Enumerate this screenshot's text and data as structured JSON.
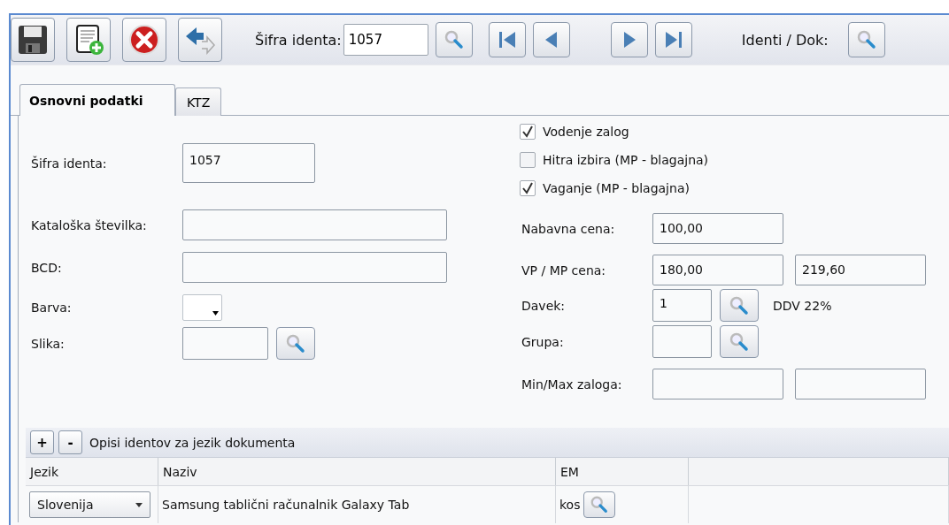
{
  "toolbar": {
    "search_label": "Šifra identa:",
    "search_value": "1057",
    "lookup_label": "Identi / Dok:"
  },
  "tabs": [
    {
      "label": "Osnovni podatki",
      "selected": true
    },
    {
      "label": "KTZ",
      "selected": false
    }
  ],
  "left_fields": [
    {
      "kind": "text",
      "label": "Šifra identa:",
      "value": "1057"
    },
    {
      "kind": "wide",
      "label": "Kataloška številka:"
    },
    {
      "kind": "wide",
      "label": "BCD:"
    },
    {
      "kind": "select",
      "label": "Barva:"
    },
    {
      "kind": "lookup",
      "label": "Slika:"
    }
  ],
  "checkboxes": [
    {
      "label": "Vodenje zalog",
      "checked": true
    },
    {
      "label": "Hitra izbira (MP - blagajna)",
      "checked": false
    },
    {
      "label": "Vaganje (MP - blagajna)",
      "checked": true
    }
  ],
  "right_fields": [
    {
      "kind": "single",
      "label": "Nabavna cena:",
      "values": [
        "100,00"
      ]
    },
    {
      "kind": "pair",
      "label": "VP / MP cena:",
      "values": [
        "180,00",
        "219,60"
      ]
    },
    {
      "kind": "lookup",
      "label": "Davek:",
      "values": [
        "1"
      ],
      "note": "DDV 22%"
    },
    {
      "kind": "lookup",
      "label": "Grupa:"
    },
    {
      "kind": "pair",
      "label": "Min/Max zaloga:"
    }
  ],
  "descriptions": {
    "add": "+",
    "remove": "-",
    "title": "Opisi identov za jezik dokumenta",
    "columns": [
      "Jezik",
      "Naziv",
      "EM"
    ],
    "rows": [
      {
        "language": "Slovenija",
        "name": "Samsung tablični računalnik Galaxy Tab",
        "unit": "kos"
      }
    ]
  }
}
